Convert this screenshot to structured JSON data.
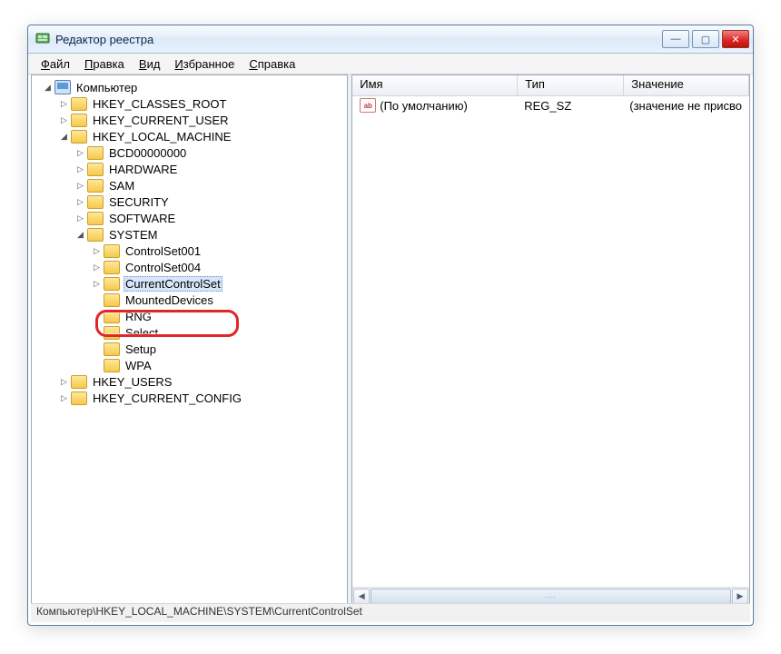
{
  "title": "Редактор реестра",
  "winbuttons": {
    "min": "—",
    "max": "▢",
    "close": "✕"
  },
  "menu": [
    "Файл",
    "Правка",
    "Вид",
    "Избранное",
    "Справка"
  ],
  "menu_ul": [
    "Ф",
    "П",
    "В",
    "И",
    "С"
  ],
  "columns": {
    "name": "Имя",
    "type": "Тип",
    "value": "Значение"
  },
  "row": {
    "name": "(По умолчанию)",
    "type": "REG_SZ",
    "value": "(значение не присво"
  },
  "statusbar": "Компьютер\\HKEY_LOCAL_MACHINE\\SYSTEM\\CurrentControlSet",
  "tree": {
    "root": "Компьютер",
    "hives": [
      "HKEY_CLASSES_ROOT",
      "HKEY_CURRENT_USER",
      "HKEY_LOCAL_MACHINE",
      "HKEY_USERS",
      "HKEY_CURRENT_CONFIG"
    ],
    "hklm": [
      "BCD00000000",
      "HARDWARE",
      "SAM",
      "SECURITY",
      "SOFTWARE",
      "SYSTEM"
    ],
    "system": [
      "ControlSet001",
      "ControlSet004",
      "CurrentControlSet",
      "MountedDevices",
      "RNG",
      "Select",
      "Setup",
      "WPA"
    ]
  },
  "icons": {
    "reg_ab": "ab"
  },
  "colors": {
    "highlight": "#e02626",
    "selection": "#d6e7fb"
  }
}
